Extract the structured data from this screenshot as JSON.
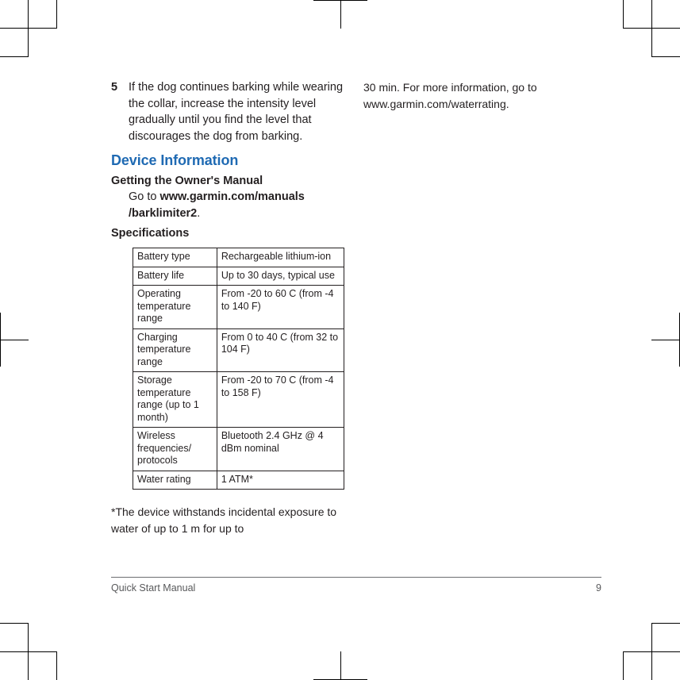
{
  "document": {
    "footer": {
      "title": "Quick Start Manual",
      "page_number": "9"
    }
  },
  "colors": {
    "section_heading": "#1f6ab3",
    "body_text": "#231f20",
    "footer_text": "#58595b",
    "rule": "#6d6e71"
  },
  "left_column": {
    "step": {
      "number": "5",
      "text": "If the dog continues barking while wearing the collar, increase the intensity level gradually until you find the level that discourages the dog from barking."
    },
    "section_heading": "Device Information",
    "owners_manual": {
      "heading": "Getting the Owner's Manual",
      "lead_in": "Go to ",
      "url": "www.garmin.com/manuals /barklimiter2",
      "trailing": "."
    },
    "specifications": {
      "heading": "Specifications",
      "rows": [
        {
          "label": "Battery type",
          "value": "Rechargeable lithium-ion"
        },
        {
          "label": "Battery life",
          "value": "Up to 30 days, typical use"
        },
        {
          "label": "Operating temperature range",
          "value": "From -20  to 60  C (from -4  to 140  F)"
        },
        {
          "label": "Charging temperature range",
          "value": "From 0  to 40  C (from 32  to 104  F)"
        },
        {
          "label": "Storage temperature range (up to 1 month)",
          "value": "From -20  to 70  C (from -4  to 158  F)"
        },
        {
          "label": "Wireless frequencies/ protocols",
          "value": "Bluetooth 2.4 GHz @ 4 dBm nominal"
        },
        {
          "label": "Water rating",
          "value": "1 ATM*"
        }
      ]
    },
    "footnote": "*The device withstands incidental exposure to water of up to 1 m for up to"
  },
  "right_column": {
    "continuation": "30 min. For more information, go to www.garmin.com/waterrating."
  }
}
